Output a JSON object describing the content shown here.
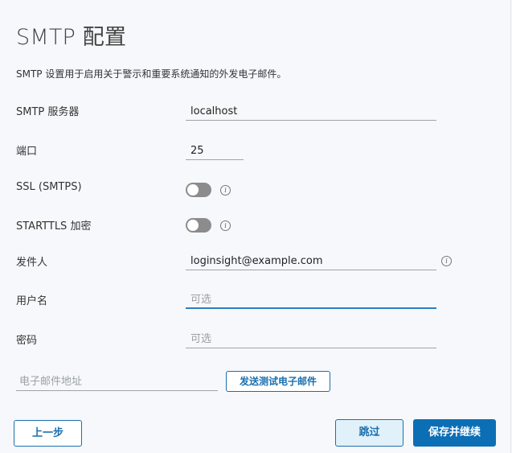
{
  "dialog": {
    "title": "SMTP 配置",
    "description": "SMTP 设置用于启用关于警示和重要系统通知的外发电子邮件。"
  },
  "fields": {
    "smtp_server": {
      "label": "SMTP 服务器",
      "value": "localhost"
    },
    "port": {
      "label": "端口",
      "value": "25"
    },
    "ssl": {
      "label": "SSL (SMTPS)",
      "enabled": false,
      "info_icon": "info-icon"
    },
    "starttls": {
      "label": "STARTTLS 加密",
      "enabled": false,
      "info_icon": "info-icon"
    },
    "sender": {
      "label": "发件人",
      "value": "loginsight@example.com",
      "info_icon": "info-icon"
    },
    "username": {
      "label": "用户名",
      "value": "",
      "placeholder": "可选"
    },
    "password": {
      "label": "密码",
      "value": "",
      "placeholder": "可选"
    }
  },
  "test": {
    "email_placeholder": "电子邮件地址",
    "send_button": "发送测试电子邮件"
  },
  "footer": {
    "back": "上一步",
    "skip": "跳过",
    "save_continue": "保存并继续"
  },
  "colors": {
    "accent": "#0c6fb5",
    "toggle_off": "#8c8c8c",
    "focus": "#2f7ebd"
  }
}
